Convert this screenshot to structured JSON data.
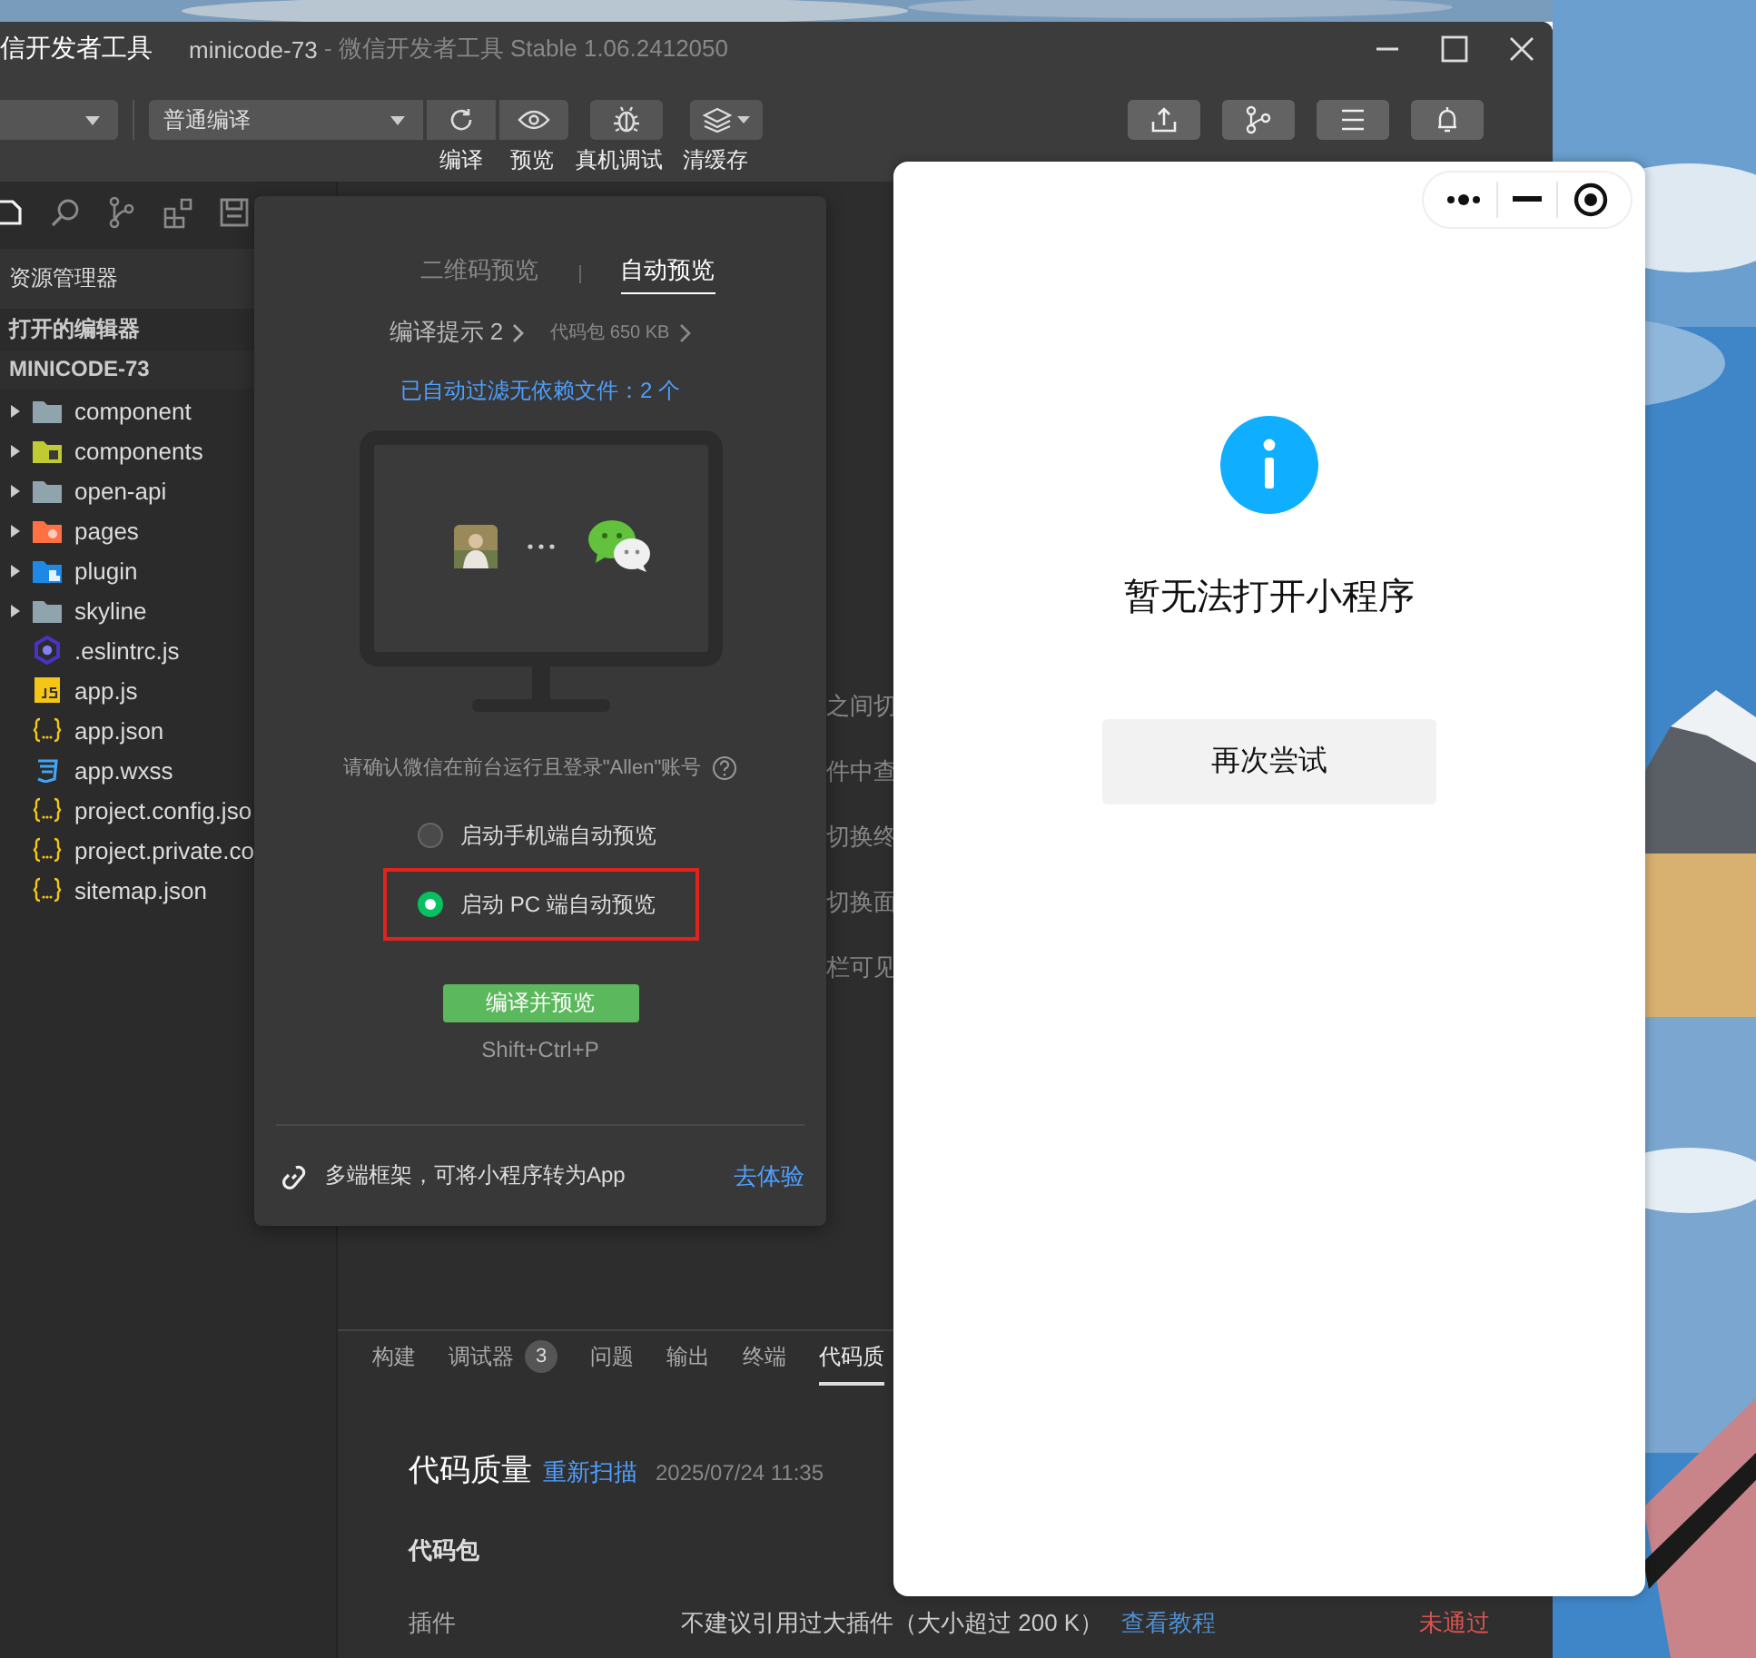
{
  "window": {
    "app_title": "信开发者工具",
    "project": "minicode-73",
    "version": " - 微信开发者工具 Stable 1.06.2412050"
  },
  "toolbar": {
    "compile_mode": "普通编译",
    "buttons": [
      {
        "kind": "compile",
        "label": "编译"
      },
      {
        "kind": "preview",
        "label": "预览"
      },
      {
        "kind": "debug",
        "label": "真机调试"
      },
      {
        "kind": "cache",
        "label": "清缓存"
      }
    ],
    "right_buttons": [
      {
        "kind": "upload"
      },
      {
        "kind": "version"
      },
      {
        "kind": "details"
      },
      {
        "kind": "messages"
      }
    ]
  },
  "sidebar": {
    "tabs": [
      {
        "kind": "files",
        "selected": true
      },
      {
        "kind": "search",
        "selected": false
      },
      {
        "kind": "source-control",
        "selected": false
      },
      {
        "kind": "extensions",
        "selected": false
      },
      {
        "kind": "storage",
        "selected": false
      }
    ],
    "header": "资源管理器",
    "open_editors": "打开的编辑器",
    "project": "MINICODE-73",
    "tree": [
      {
        "name": "component",
        "kind": "folder",
        "expanded": false
      },
      {
        "name": "components",
        "kind": "folder-components",
        "expanded": false
      },
      {
        "name": "open-api",
        "kind": "folder",
        "expanded": false
      },
      {
        "name": "pages",
        "kind": "folder-pages",
        "expanded": false
      },
      {
        "name": "plugin",
        "kind": "folder-plugin",
        "expanded": false
      },
      {
        "name": "skyline",
        "kind": "folder",
        "expanded": false
      },
      {
        "name": ".eslintrc.js",
        "kind": "eslint"
      },
      {
        "name": "app.js",
        "kind": "js"
      },
      {
        "name": "app.json",
        "kind": "json"
      },
      {
        "name": "app.wxss",
        "kind": "wxss"
      },
      {
        "name": "project.config.jso",
        "kind": "json"
      },
      {
        "name": "project.private.co",
        "kind": "json"
      },
      {
        "name": "sitemap.json",
        "kind": "json"
      }
    ]
  },
  "editor": {
    "fragments": [
      "之间切",
      "件中查",
      "切换终",
      "切换面",
      "栏可见"
    ]
  },
  "preview_popup": {
    "tabs": [
      {
        "label": "二维码预览",
        "selected": false
      },
      {
        "label": "自动预览",
        "selected": true
      }
    ],
    "compile_hint": "编译提示 2",
    "package": "代码包 650 KB",
    "filter_note": "已自动过滤无依赖文件：2 个",
    "confirm": "请确认微信在前台运行且登录\"Allen\"账号",
    "options": [
      {
        "label": "启动手机端自动预览",
        "selected": false,
        "highlighted": false
      },
      {
        "label": "启动 PC 端自动预览",
        "selected": true,
        "highlighted": true
      }
    ],
    "action": "编译并预览",
    "shortcut": "Shift+Ctrl+P",
    "footer": "多端框架，可将小程序转为App",
    "footer_link": "去体验"
  },
  "bottom_panel": {
    "tabs": [
      {
        "label": "构建",
        "selected": false
      },
      {
        "label": "调试器",
        "selected": false,
        "badge": "3"
      },
      {
        "label": "问题",
        "selected": false
      },
      {
        "label": "输出",
        "selected": false
      },
      {
        "label": "终端",
        "selected": false
      },
      {
        "label": "代码质",
        "selected": true
      }
    ],
    "title": "代码质量",
    "rescan": "重新扫描",
    "timestamp": "2025/07/24 11:35",
    "section": "代码包",
    "rows": [
      {
        "name": "插件",
        "description": "不建议引用过大插件（大小超过 200 K）",
        "link": "查看教程",
        "status": "未通过",
        "passed": false
      }
    ]
  },
  "simulator": {
    "message": "暂无法打开小程序",
    "retry": "再次尝试"
  }
}
